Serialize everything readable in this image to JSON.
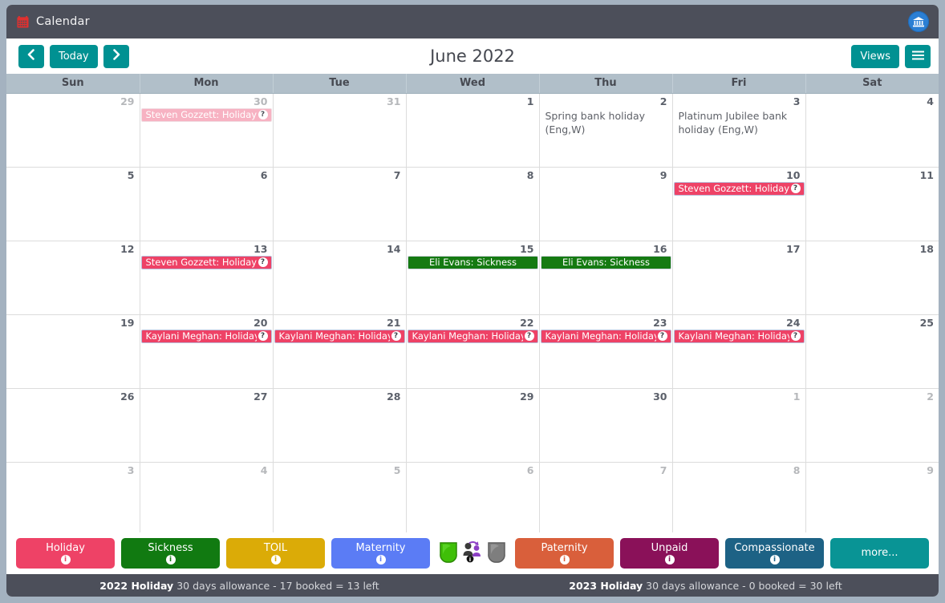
{
  "window": {
    "title": "Calendar",
    "title_icon": "calendar-icon",
    "bank_icon": "bank-institution-icon"
  },
  "toolbar": {
    "prev_label": "‹",
    "prev_icon": "chevron-left-icon",
    "today_label": "Today",
    "next_label": "›",
    "next_icon": "chevron-right-icon",
    "month_title": "June 2022",
    "views_label": "Views",
    "menu_icon": "hamburger-menu-icon"
  },
  "calendar": {
    "weekday_headers": [
      "Sun",
      "Mon",
      "Tue",
      "Wed",
      "Thu",
      "Fri",
      "Sat"
    ],
    "weeks": [
      [
        {
          "day": "29",
          "other": true,
          "weekend": true
        },
        {
          "day": "30",
          "other": true,
          "events": [
            {
              "text": "Steven Gozzett: Holiday",
              "type": "holiday-faded",
              "badge": "?"
            }
          ]
        },
        {
          "day": "31",
          "other": true
        },
        {
          "day": "1"
        },
        {
          "day": "2",
          "bankholiday": "Spring bank holiday (Eng,W)"
        },
        {
          "day": "3",
          "bankholiday": "Platinum Jubilee bank holiday (Eng,W)"
        },
        {
          "day": "4",
          "weekend": true
        }
      ],
      [
        {
          "day": "5",
          "weekend": true
        },
        {
          "day": "6"
        },
        {
          "day": "7"
        },
        {
          "day": "8",
          "today": true
        },
        {
          "day": "9"
        },
        {
          "day": "10",
          "events": [
            {
              "text": "Steven Gozzett: Holiday",
              "type": "holiday",
              "badge": "?"
            }
          ]
        },
        {
          "day": "11",
          "weekend": true
        }
      ],
      [
        {
          "day": "12",
          "weekend": true
        },
        {
          "day": "13",
          "events": [
            {
              "text": "Steven Gozzett: Holiday",
              "type": "holiday",
              "badge": "?"
            }
          ]
        },
        {
          "day": "14"
        },
        {
          "day": "15",
          "events": [
            {
              "text": "Eli Evans: Sickness",
              "type": "sickness",
              "center": true
            }
          ]
        },
        {
          "day": "16",
          "events": [
            {
              "text": "Eli Evans: Sickness",
              "type": "sickness",
              "center": true
            }
          ]
        },
        {
          "day": "17"
        },
        {
          "day": "18",
          "weekend": true
        }
      ],
      [
        {
          "day": "19",
          "weekend": true
        },
        {
          "day": "20",
          "events": [
            {
              "text": "Kaylani Meghan: Holiday",
              "type": "holiday",
              "badge": "?"
            }
          ]
        },
        {
          "day": "21",
          "events": [
            {
              "text": "Kaylani Meghan: Holiday",
              "type": "holiday",
              "badge": "?"
            }
          ]
        },
        {
          "day": "22",
          "events": [
            {
              "text": "Kaylani Meghan: Holiday",
              "type": "holiday",
              "badge": "?"
            }
          ]
        },
        {
          "day": "23",
          "events": [
            {
              "text": "Kaylani Meghan: Holiday",
              "type": "holiday",
              "badge": "?"
            }
          ]
        },
        {
          "day": "24",
          "events": [
            {
              "text": "Kaylani Meghan: Holiday",
              "type": "holiday",
              "badge": "?"
            }
          ]
        },
        {
          "day": "25",
          "weekend": true
        }
      ],
      [
        {
          "day": "26",
          "weekend": true
        },
        {
          "day": "27"
        },
        {
          "day": "28"
        },
        {
          "day": "29"
        },
        {
          "day": "30"
        },
        {
          "day": "1",
          "other": true
        },
        {
          "day": "2",
          "other": true,
          "weekend": true
        }
      ],
      [
        {
          "day": "3",
          "other": true,
          "weekend": true
        },
        {
          "day": "4",
          "other": true
        },
        {
          "day": "5",
          "other": true
        },
        {
          "day": "6",
          "other": true
        },
        {
          "day": "7",
          "other": true
        },
        {
          "day": "8",
          "other": true
        },
        {
          "day": "9",
          "other": true,
          "weekend": true
        }
      ]
    ]
  },
  "legend": {
    "buttons": [
      {
        "label": "Holiday",
        "color": "#ee4266",
        "info": "i"
      },
      {
        "label": "Sickness",
        "color": "#117a11",
        "info": "i"
      },
      {
        "label": "TOIL",
        "color": "#dbab07",
        "info": "i"
      },
      {
        "label": "Maternity",
        "color": "#5b7cf5",
        "info": "i"
      }
    ],
    "icons": [
      {
        "name": "green-shield-icon",
        "color": "#3fbf08"
      },
      {
        "name": "user-swap-icon",
        "color": "#7d3fb5"
      },
      {
        "name": "grey-shield-icon",
        "color": "#7e7e7e"
      }
    ],
    "buttons2": [
      {
        "label": "Paternity",
        "color": "#d95f3b",
        "info": "i"
      },
      {
        "label": "Unpaid",
        "color": "#8a1159",
        "info": "i"
      },
      {
        "label": "Compassionate",
        "color": "#1d6285",
        "info": "i"
      }
    ],
    "more_label": "more...",
    "more_color": "#099495"
  },
  "allowances": [
    {
      "year": "2022 Holiday",
      "detail": "30 days allowance - 17 booked = 13 left"
    },
    {
      "year": "2023 Holiday",
      "detail": "30 days allowance - 0 booked = 30 left"
    }
  ]
}
